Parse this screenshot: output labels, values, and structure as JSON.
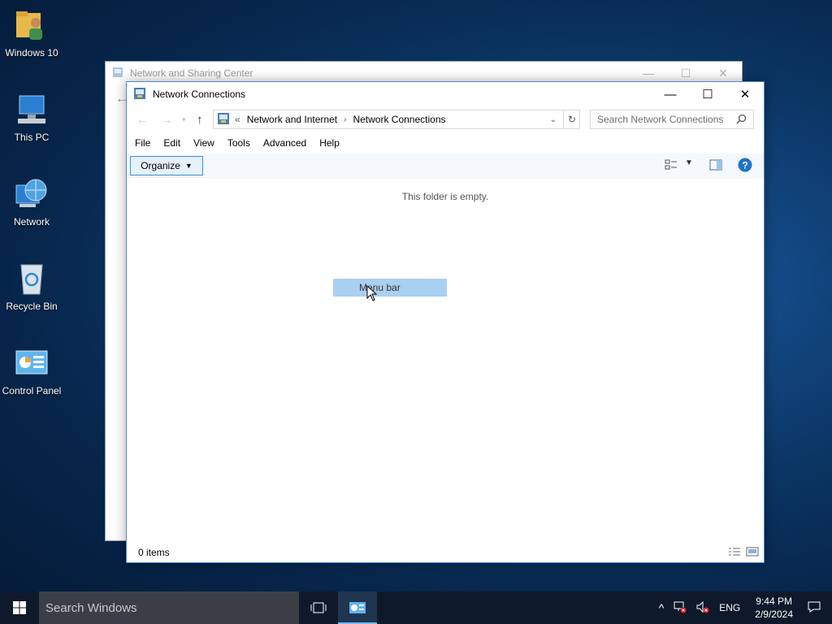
{
  "desktop": {
    "icons": [
      {
        "label": "Windows 10",
        "icon": "user-folder-icon"
      },
      {
        "label": "This PC",
        "icon": "computer-icon"
      },
      {
        "label": "Network",
        "icon": "network-globe-icon"
      },
      {
        "label": "Recycle Bin",
        "icon": "recycle-bin-icon"
      },
      {
        "label": "Control Panel",
        "icon": "control-panel-icon"
      }
    ]
  },
  "background_window": {
    "title": "Network and Sharing Center"
  },
  "window": {
    "title": "Network Connections",
    "breadcrumb": {
      "overflow": "«",
      "items": [
        "Network and Internet",
        "Network Connections"
      ]
    },
    "search_placeholder": "Search Network Connections",
    "menu": [
      "File",
      "Edit",
      "View",
      "Tools",
      "Advanced",
      "Help"
    ],
    "organize_label": "Organize",
    "empty_message": "This folder is empty.",
    "tooltip": "Menu bar",
    "status": "0 items"
  },
  "taskbar": {
    "search_placeholder": "Search Windows",
    "language": "ENG",
    "time": "9:44 PM",
    "date": "2/9/2024"
  },
  "colors": {
    "accent": "#0078d7",
    "tooltip_bg": "#a9d0f0",
    "taskbar_bg": "#0e1a2b"
  }
}
